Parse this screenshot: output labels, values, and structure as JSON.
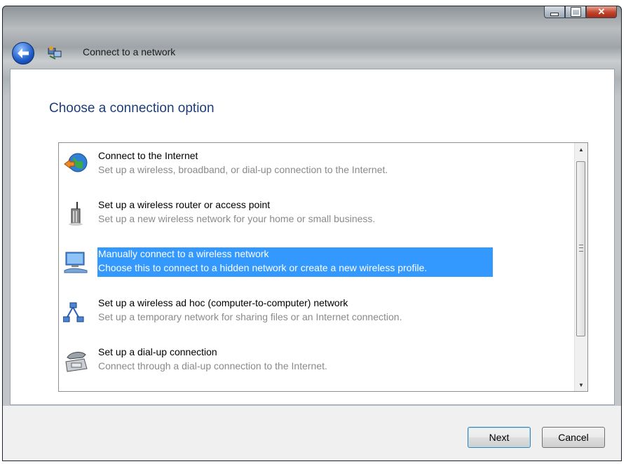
{
  "window": {
    "title": "Connect to a network",
    "caption_buttons": {
      "minimize": "minimize",
      "maximize": "maximize",
      "close": "close"
    }
  },
  "heading": "Choose a connection option",
  "options": [
    {
      "title": "Connect to the Internet",
      "description": "Set up a wireless, broadband, or dial-up connection to the Internet.",
      "icon": "globe-icon",
      "selected": false
    },
    {
      "title": "Set up a wireless router or access point",
      "description": "Set up a new wireless network for your home or small business.",
      "icon": "router-icon",
      "selected": false
    },
    {
      "title": "Manually connect to a wireless network",
      "description": "Choose this to connect to a hidden network or create a new wireless profile.",
      "icon": "computer-wireless-icon",
      "selected": true
    },
    {
      "title": "Set up a wireless ad hoc (computer-to-computer) network",
      "description": "Set up a temporary network for sharing files or an Internet connection.",
      "icon": "adhoc-network-icon",
      "selected": false
    },
    {
      "title": "Set up a dial-up connection",
      "description": "Connect through a dial-up connection to the Internet.",
      "icon": "phone-icon",
      "selected": false
    }
  ],
  "buttons": {
    "next": "Next",
    "cancel": "Cancel"
  },
  "colors": {
    "selection": "#3399ff",
    "heading": "#1e3e7a"
  }
}
